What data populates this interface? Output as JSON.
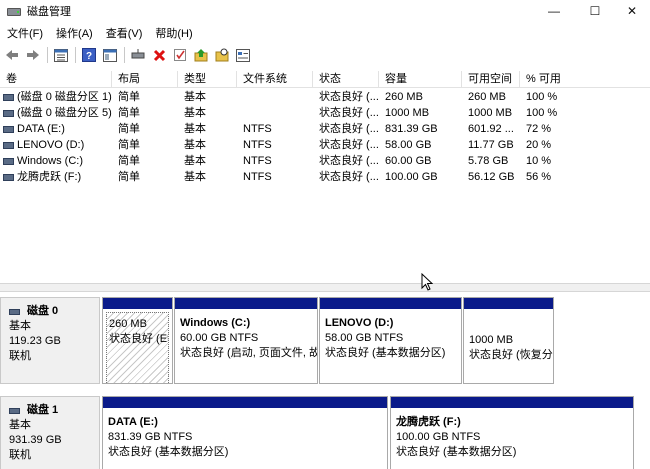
{
  "window": {
    "title": "磁盘管理",
    "minimize_glyph": "—",
    "maximize_glyph": "☐",
    "close_glyph": "✕"
  },
  "menu": [
    "文件(F)",
    "操作(A)",
    "查看(V)",
    "帮助(H)"
  ],
  "toolbar": {
    "icons": [
      "back-arrow-icon",
      "forward-arrow-icon",
      "properties-list-icon",
      "help-icon",
      "console-tree-icon",
      "connect-disk-icon",
      "delete-icon",
      "check-icon",
      "up-folder-icon",
      "folder-search-icon",
      "view-icon"
    ]
  },
  "volumes": {
    "columns": [
      "卷",
      "布局",
      "类型",
      "文件系统",
      "状态",
      "容量",
      "可用空间",
      "% 可用"
    ],
    "rows": [
      {
        "volume": "(磁盘 0 磁盘分区 1)",
        "layout": "简单",
        "type": "基本",
        "fs": "",
        "status": "状态良好 (...",
        "capacity": "260 MB",
        "free": "260 MB",
        "pct": "100 %"
      },
      {
        "volume": "(磁盘 0 磁盘分区 5)",
        "layout": "简单",
        "type": "基本",
        "fs": "",
        "status": "状态良好 (...",
        "capacity": "1000 MB",
        "free": "1000 MB",
        "pct": "100 %"
      },
      {
        "volume": "DATA (E:)",
        "layout": "简单",
        "type": "基本",
        "fs": "NTFS",
        "status": "状态良好 (...",
        "capacity": "831.39 GB",
        "free": "601.92 ...",
        "pct": "72 %"
      },
      {
        "volume": "LENOVO (D:)",
        "layout": "简单",
        "type": "基本",
        "fs": "NTFS",
        "status": "状态良好 (...",
        "capacity": "58.00 GB",
        "free": "11.77 GB",
        "pct": "20 %"
      },
      {
        "volume": "Windows (C:)",
        "layout": "简单",
        "type": "基本",
        "fs": "NTFS",
        "status": "状态良好 (...",
        "capacity": "60.00 GB",
        "free": "5.78 GB",
        "pct": "10 %"
      },
      {
        "volume": "龙腾虎跃 (F:)",
        "layout": "简单",
        "type": "基本",
        "fs": "NTFS",
        "status": "状态良好 (...",
        "capacity": "100.00 GB",
        "free": "56.12 GB",
        "pct": "56 %"
      }
    ]
  },
  "disks": [
    {
      "name": "磁盘 0",
      "type": "基本",
      "size": "119.23 GB",
      "state": "联机",
      "partitions": [
        {
          "name": "",
          "size_fs": "260 MB",
          "status": "状态良好 (EFI"
        },
        {
          "name": "Windows  (C:)",
          "size_fs": "60.00 GB NTFS",
          "status": "状态良好 (启动, 页面文件, 故"
        },
        {
          "name": "LENOVO  (D:)",
          "size_fs": "58.00 GB NTFS",
          "status": "状态良好 (基本数据分区)"
        },
        {
          "name": "",
          "size_fs": "1000 MB",
          "status": "状态良好 (恢复分"
        }
      ]
    },
    {
      "name": "磁盘 1",
      "type": "基本",
      "size": "931.39 GB",
      "state": "联机",
      "partitions": [
        {
          "name": "DATA  (E:)",
          "size_fs": "831.39 GB NTFS",
          "status": "状态良好 (基本数据分区)"
        },
        {
          "name": "龙腾虎跃  (F:)",
          "size_fs": "100.00 GB NTFS",
          "status": "状态良好 (基本数据分区)"
        }
      ]
    }
  ],
  "colors": {
    "partition_bar": "#0a1a8a",
    "disk_label_bg": "#f0f0f0"
  }
}
